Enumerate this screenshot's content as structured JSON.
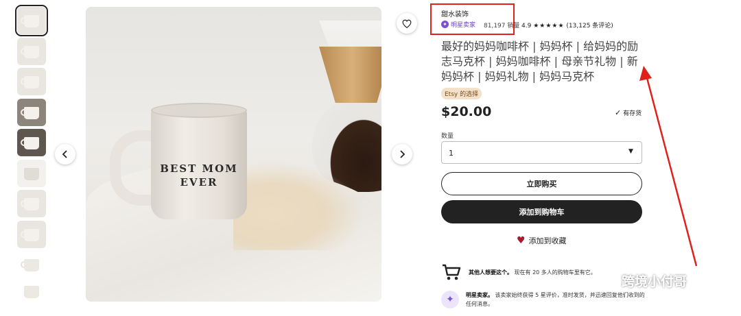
{
  "shop": {
    "name": "甜水装饰",
    "star_seller": "明星卖家",
    "sales": "81,197 销量",
    "rating": "4.9",
    "stars": "★★★★★",
    "reviews": "(13,125 条评论)"
  },
  "product": {
    "title": "最好的妈妈咖啡杯 | 妈妈杯 | 给妈妈的励志马克杯 | 妈妈咖啡杯 | 母亲节礼物 | 新妈妈杯 | 妈妈礼物 | 妈妈马克杯",
    "etsy_pick": "Etsy 的选择",
    "price": "$20.00",
    "stock": "有存货",
    "mug_line1": "BEST MOM",
    "mug_line2": "EVER"
  },
  "quantity": {
    "label": "数量",
    "selected": "1"
  },
  "actions": {
    "buy_now": "立即购买",
    "add_to_cart": "添加到购物车",
    "add_to_favorites": "添加到收藏"
  },
  "info": {
    "demand_bold": "其他人想要这个。",
    "demand_text": "现在有 20 多人的购物车里有它。",
    "star_bold": "明星卖家。",
    "star_text": "该卖家始终获得 5 星评价，准时发货，并迅速回复他们收到的任何消息。"
  },
  "watermark": "跨境小付哥",
  "icons": {
    "favorite": "heart-outline-icon",
    "prev": "chevron-left-icon",
    "next": "chevron-right-icon",
    "cart": "shopping-cart-icon",
    "star_seller": "star-badge-icon"
  },
  "colors": {
    "annotation_red": "#e0201a",
    "star_seller_purple": "#7b4fd6",
    "primary_button": "#222222"
  }
}
